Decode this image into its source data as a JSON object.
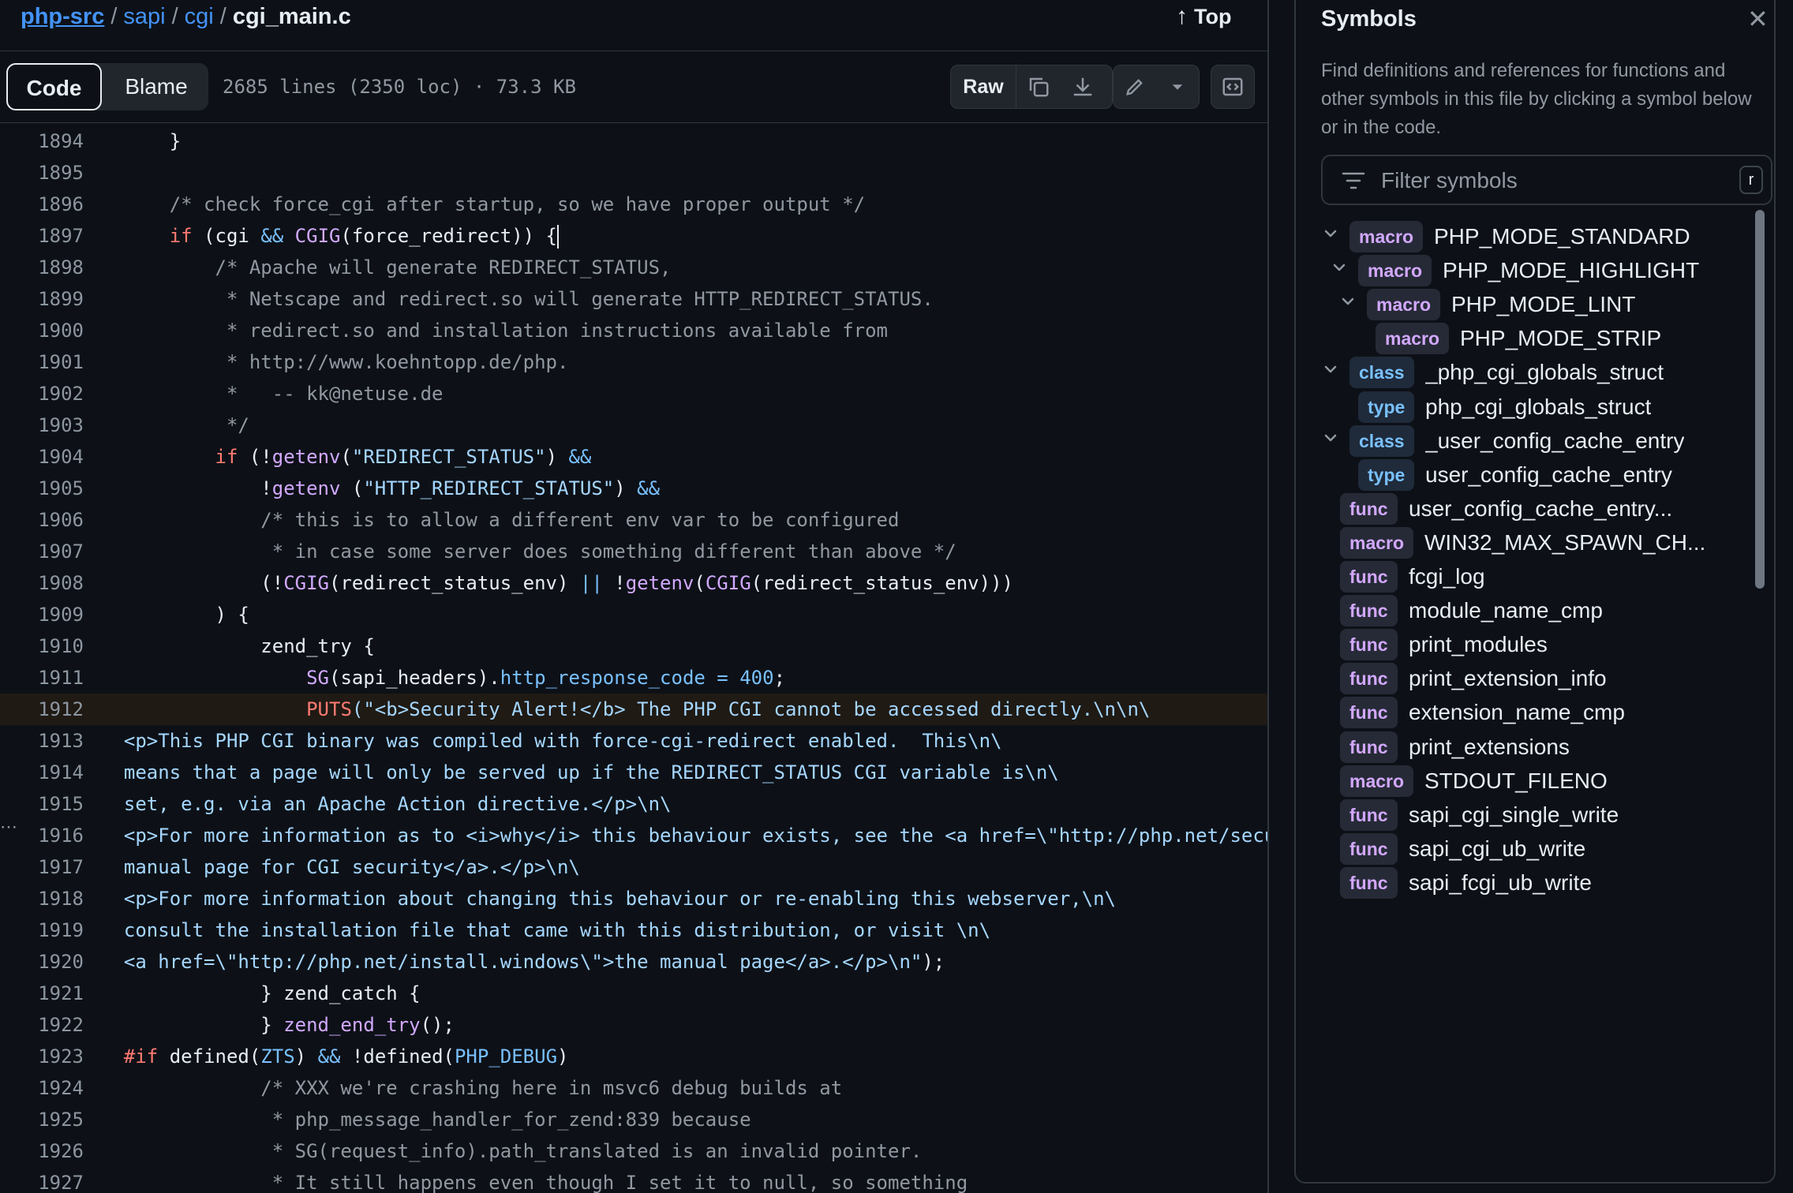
{
  "breadcrumb": {
    "repo": "php-src",
    "sep": "/",
    "dir1": "sapi",
    "dir2": "cgi",
    "file": "cgi_main.c"
  },
  "top_link": "Top",
  "toolbar": {
    "code_tab": "Code",
    "blame_tab": "Blame",
    "file_meta": "2685 lines (2350 loc) · 73.3 KB",
    "raw_label": "Raw",
    "icons": [
      "copy-icon",
      "download-icon",
      "pencil-icon",
      "chevron-down-icon",
      "symbols-panel-icon"
    ]
  },
  "code": {
    "highlighted_line": "1912",
    "line_numbers": [
      "1894",
      "1895",
      "1896",
      "1897",
      "1898",
      "1899",
      "1900",
      "1901",
      "1902",
      "1903",
      "1904",
      "1905",
      "1906",
      "1907",
      "1908",
      "1909",
      "1910",
      "1911",
      "1912",
      "1913",
      "1914",
      "1915",
      "1916",
      "1917",
      "1918",
      "1919",
      "1920",
      "1921",
      "1922",
      "1923",
      "1924",
      "1925",
      "1926",
      "1927"
    ],
    "lines": [
      [
        {
          "t": "      }",
          "c": ""
        }
      ],
      [
        {
          "t": "",
          "c": ""
        }
      ],
      [
        {
          "t": "      /* check force_cgi after startup, so we have proper output */",
          "c": "cm"
        }
      ],
      [
        {
          "t": "      ",
          "c": ""
        },
        {
          "t": "if",
          "c": "kw"
        },
        {
          "t": " (cgi ",
          "c": ""
        },
        {
          "t": "&&",
          "c": "cs"
        },
        {
          "t": " ",
          "c": ""
        },
        {
          "t": "CGIG",
          "c": "fn"
        },
        {
          "t": "(force_redirect)) {",
          "c": ""
        },
        {
          "t": "",
          "c": "cursor"
        }
      ],
      [
        {
          "t": "          /* Apache will generate REDIRECT_STATUS,",
          "c": "cm"
        }
      ],
      [
        {
          "t": "           * Netscape and redirect.so will generate HTTP_REDIRECT_STATUS.",
          "c": "cm"
        }
      ],
      [
        {
          "t": "           * redirect.so and installation instructions available from",
          "c": "cm"
        }
      ],
      [
        {
          "t": "           * http://www.koehntopp.de/php.",
          "c": "cm"
        }
      ],
      [
        {
          "t": "           *   -- kk@netuse.de",
          "c": "cm"
        }
      ],
      [
        {
          "t": "           */",
          "c": "cm"
        }
      ],
      [
        {
          "t": "          ",
          "c": ""
        },
        {
          "t": "if",
          "c": "kw"
        },
        {
          "t": " (!",
          "c": ""
        },
        {
          "t": "getenv",
          "c": "fn"
        },
        {
          "t": "(",
          "c": ""
        },
        {
          "t": "\"REDIRECT_STATUS\"",
          "c": "st"
        },
        {
          "t": ") ",
          "c": ""
        },
        {
          "t": "&&",
          "c": "cs"
        }
      ],
      [
        {
          "t": "              !",
          "c": ""
        },
        {
          "t": "getenv",
          "c": "fn"
        },
        {
          "t": " (",
          "c": ""
        },
        {
          "t": "\"HTTP_REDIRECT_STATUS\"",
          "c": "st"
        },
        {
          "t": ") ",
          "c": ""
        },
        {
          "t": "&&",
          "c": "cs"
        }
      ],
      [
        {
          "t": "              /* this is to allow a different env var to be configured",
          "c": "cm"
        }
      ],
      [
        {
          "t": "               * in case some server does something different than above */",
          "c": "cm"
        }
      ],
      [
        {
          "t": "              (!",
          "c": ""
        },
        {
          "t": "CGIG",
          "c": "fn"
        },
        {
          "t": "(redirect_status_env) ",
          "c": ""
        },
        {
          "t": "||",
          "c": "cs"
        },
        {
          "t": " !",
          "c": ""
        },
        {
          "t": "getenv",
          "c": "fn"
        },
        {
          "t": "(",
          "c": ""
        },
        {
          "t": "CGIG",
          "c": "fn"
        },
        {
          "t": "(redirect_status_env)))",
          "c": ""
        }
      ],
      [
        {
          "t": "          ) {",
          "c": ""
        }
      ],
      [
        {
          "t": "              zend_try {",
          "c": ""
        }
      ],
      [
        {
          "t": "                  ",
          "c": ""
        },
        {
          "t": "SG",
          "c": "fn"
        },
        {
          "t": "(sapi_headers).",
          "c": ""
        },
        {
          "t": "http_response_code",
          "c": "cs"
        },
        {
          "t": " ",
          "c": ""
        },
        {
          "t": "=",
          "c": "cs"
        },
        {
          "t": " ",
          "c": ""
        },
        {
          "t": "400",
          "c": "cs"
        },
        {
          "t": ";",
          "c": ""
        }
      ],
      [
        {
          "t": "                  ",
          "c": ""
        },
        {
          "t": "PUTS",
          "c": "kw"
        },
        {
          "t": "(\"<b>Security Alert!</b> The PHP CGI cannot be accessed directly.\\n\\n\\",
          "c": "st"
        }
      ],
      [
        {
          "t": "  <p>This PHP CGI binary was compiled with force-cgi-redirect enabled.  This\\n\\",
          "c": "st"
        }
      ],
      [
        {
          "t": "  means that a page will only be served up if the REDIRECT_STATUS CGI variable is\\n\\",
          "c": "st"
        }
      ],
      [
        {
          "t": "  set, e.g. via an Apache Action directive.</p>\\n\\",
          "c": "st"
        }
      ],
      [
        {
          "t": "  <p>For more information as to <i>why</i> this behaviour exists, see the <a href=\\\"http://php.net/security.cgi-bin\\\">\\",
          "c": "st"
        }
      ],
      [
        {
          "t": "  manual page for CGI security</a>.</p>\\n\\",
          "c": "st"
        }
      ],
      [
        {
          "t": "  <p>For more information about changing this behaviour or re-enabling this webserver,\\n\\",
          "c": "st"
        }
      ],
      [
        {
          "t": "  consult the installation file that came with this distribution, or visit \\n\\",
          "c": "st"
        }
      ],
      [
        {
          "t": "  <a href=\\\"http://php.net/install.windows\\\">the manual page</a>.</p>\\n\"",
          "c": "st"
        },
        {
          "t": ");",
          "c": ""
        }
      ],
      [
        {
          "t": "              } zend_catch {",
          "c": ""
        }
      ],
      [
        {
          "t": "              } ",
          "c": ""
        },
        {
          "t": "zend_end_try",
          "c": "fn"
        },
        {
          "t": "();",
          "c": ""
        }
      ],
      [
        {
          "t": "  ",
          "c": ""
        },
        {
          "t": "#if",
          "c": "kw"
        },
        {
          "t": " defined(",
          "c": ""
        },
        {
          "t": "ZTS",
          "c": "cs"
        },
        {
          "t": ") ",
          "c": ""
        },
        {
          "t": "&&",
          "c": "cs"
        },
        {
          "t": " !defined(",
          "c": ""
        },
        {
          "t": "PHP_DEBUG",
          "c": "cs"
        },
        {
          "t": ")",
          "c": ""
        }
      ],
      [
        {
          "t": "              /* XXX we're crashing here in msvc6 debug builds at",
          "c": "cm"
        }
      ],
      [
        {
          "t": "               * php_message_handler_for_zend:839 because",
          "c": "cm"
        }
      ],
      [
        {
          "t": "               * SG(request_info).path_translated is an invalid pointer.",
          "c": "cm"
        }
      ],
      [
        {
          "t": "               * It still happens even though I set it to null, so something",
          "c": "cm"
        }
      ]
    ]
  },
  "symbols": {
    "title": "Symbols",
    "description": "Find definitions and references for functions and other symbols in this file by clicking a symbol below or in the code.",
    "filter_placeholder": "Filter symbols",
    "filter_shortcut": "r",
    "items": [
      {
        "kind": "macro",
        "name": "PHP_MODE_STANDARD",
        "depth": 0,
        "expandable": true
      },
      {
        "kind": "macro",
        "name": "PHP_MODE_HIGHLIGHT",
        "depth": 1,
        "expandable": true
      },
      {
        "kind": "macro",
        "name": "PHP_MODE_LINT",
        "depth": 2,
        "expandable": true
      },
      {
        "kind": "macro",
        "name": "PHP_MODE_STRIP",
        "depth": 3,
        "expandable": false
      },
      {
        "kind": "class",
        "name": "_php_cgi_globals_struct",
        "depth": 0,
        "expandable": true
      },
      {
        "kind": "type",
        "name": "php_cgi_globals_struct",
        "depth": 1,
        "expandable": false
      },
      {
        "kind": "class",
        "name": "_user_config_cache_entry",
        "depth": 0,
        "expandable": true
      },
      {
        "kind": "type",
        "name": "user_config_cache_entry",
        "depth": 1,
        "expandable": false
      },
      {
        "kind": "func",
        "name": "user_config_cache_entry...",
        "depth": 0,
        "expandable": false
      },
      {
        "kind": "macro",
        "name": "WIN32_MAX_SPAWN_CH...",
        "depth": 0,
        "expandable": false
      },
      {
        "kind": "func",
        "name": "fcgi_log",
        "depth": 0,
        "expandable": false
      },
      {
        "kind": "func",
        "name": "module_name_cmp",
        "depth": 0,
        "expandable": false
      },
      {
        "kind": "func",
        "name": "print_modules",
        "depth": 0,
        "expandable": false
      },
      {
        "kind": "func",
        "name": "print_extension_info",
        "depth": 0,
        "expandable": false
      },
      {
        "kind": "func",
        "name": "extension_name_cmp",
        "depth": 0,
        "expandable": false
      },
      {
        "kind": "func",
        "name": "print_extensions",
        "depth": 0,
        "expandable": false
      },
      {
        "kind": "macro",
        "name": "STDOUT_FILENO",
        "depth": 0,
        "expandable": false
      },
      {
        "kind": "func",
        "name": "sapi_cgi_single_write",
        "depth": 0,
        "expandable": false
      },
      {
        "kind": "func",
        "name": "sapi_cgi_ub_write",
        "depth": 0,
        "expandable": false
      },
      {
        "kind": "func",
        "name": "sapi_fcgi_ub_write",
        "depth": 0,
        "expandable": false
      }
    ]
  },
  "colors": {
    "bg": "#0d1117",
    "accent": "#4493f8",
    "border": "#30363d",
    "comment": "#9198a1",
    "keyword": "#ff7b72",
    "function": "#d2a8ff",
    "constant": "#79c0ff",
    "string": "#a5d6ff"
  }
}
